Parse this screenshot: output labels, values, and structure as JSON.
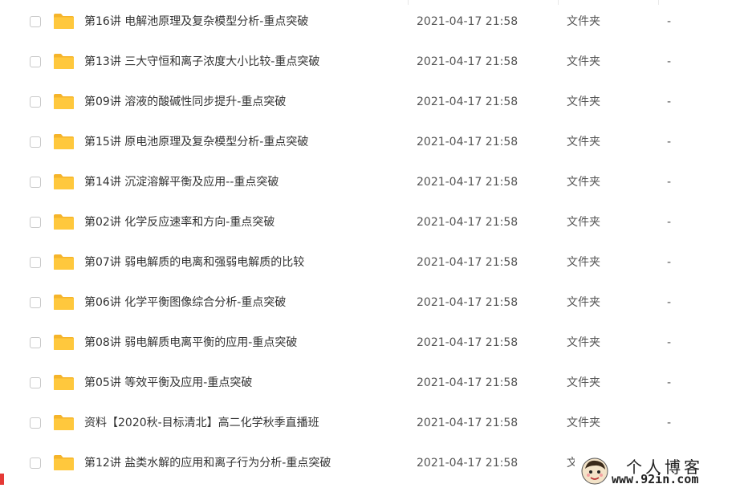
{
  "files": [
    {
      "name": "第16讲 电解池原理及复杂模型分析-重点突破",
      "date": "2021-04-17 21:58",
      "type": "文件夹",
      "size": "-"
    },
    {
      "name": "第13讲 三大守恒和离子浓度大小比较-重点突破",
      "date": "2021-04-17 21:58",
      "type": "文件夹",
      "size": "-"
    },
    {
      "name": "第09讲 溶液的酸碱性同步提升-重点突破",
      "date": "2021-04-17 21:58",
      "type": "文件夹",
      "size": "-"
    },
    {
      "name": "第15讲 原电池原理及复杂模型分析-重点突破",
      "date": "2021-04-17 21:58",
      "type": "文件夹",
      "size": "-"
    },
    {
      "name": "第14讲 沉淀溶解平衡及应用--重点突破",
      "date": "2021-04-17 21:58",
      "type": "文件夹",
      "size": "-"
    },
    {
      "name": "第02讲 化学反应速率和方向-重点突破",
      "date": "2021-04-17 21:58",
      "type": "文件夹",
      "size": "-"
    },
    {
      "name": "第07讲 弱电解质的电离和强弱电解质的比较",
      "date": "2021-04-17 21:58",
      "type": "文件夹",
      "size": "-"
    },
    {
      "name": "第06讲 化学平衡图像综合分析-重点突破",
      "date": "2021-04-17 21:58",
      "type": "文件夹",
      "size": "-"
    },
    {
      "name": "第08讲 弱电解质电离平衡的应用-重点突破",
      "date": "2021-04-17 21:58",
      "type": "文件夹",
      "size": "-"
    },
    {
      "name": "第05讲 等效平衡及应用-重点突破",
      "date": "2021-04-17 21:58",
      "type": "文件夹",
      "size": "-"
    },
    {
      "name": "资料【2020秋-目标清北】高二化学秋季直播班",
      "date": "2021-04-17 21:58",
      "type": "文件夹",
      "size": "-"
    },
    {
      "name": "第12讲 盐类水解的应用和离子行为分析-重点突破",
      "date": "2021-04-17 21:58",
      "type": "文",
      "size": ""
    }
  ],
  "icons": {
    "folder": "folder-icon",
    "checkbox": "checkbox"
  },
  "colors": {
    "folder": "#ffc83d",
    "folder_tab": "#f5b42a",
    "text": "#333333",
    "meta_text": "#555555"
  },
  "watermark": {
    "title": "个人博客",
    "url": "www.92in.com"
  }
}
